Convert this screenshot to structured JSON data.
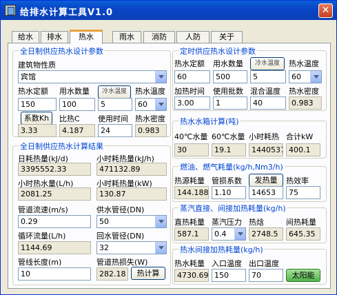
{
  "window": {
    "title": "给排水计算工具V1.0"
  },
  "tabs": [
    "给水",
    "排水",
    "热水",
    "雨水",
    "消防",
    "人防",
    "关于"
  ],
  "full_day": {
    "title": "全日制供应热水设计参数",
    "building_type_label": "建筑物性质",
    "building_type_value": "宾馆",
    "quota_label": "热水定额",
    "quota_value": "150",
    "units_label": "用水数量",
    "units_value": "100",
    "cold_temp_button": "冷水温度",
    "cold_temp_value": "5",
    "hot_temp_label": "热水温度",
    "hot_temp_value": "60",
    "coef_button": "系数Kh",
    "coef_value": "3.33",
    "specific_heat_label": "比热C",
    "specific_heat_value": "4.187",
    "use_time_label": "使用时间",
    "use_time_value": "24",
    "density_label": "热水密度",
    "density_value": "0.983"
  },
  "full_day_results": {
    "title": "全日制供应热水计算结果",
    "daily_heat_label": "日耗热量(kJ/d)",
    "daily_heat_value": "3395552.33",
    "hourly_heat_label": "小时耗热量(kJ/h)",
    "hourly_heat_value": "471132.89",
    "hourly_water_label": "小时热水量(L/h)",
    "hourly_water_value": "2081.25",
    "hourly_heat_kw_label": "小时耗热量(kW)",
    "hourly_heat_kw_value": "130.87",
    "flow_speed_label": "管道流速(m/s)",
    "flow_speed_value": "0.29",
    "supply_dia_label": "供水管径(DN)",
    "supply_dia_value": "50",
    "circ_flow_label": "循环流量(L/h)",
    "circ_flow_value": "1144.69",
    "return_dia_label": "回水管径(DN)",
    "return_dia_value": "32",
    "pipe_length_label": "管线长度(m)",
    "pipe_length_value": "10",
    "pipe_loss_label": "管道热损失(W)",
    "pipe_loss_value": "282.18",
    "calc_button": "热计算"
  },
  "timed": {
    "title": "定时供应热水设计参数",
    "quota_label": "热水定额",
    "quota_value": "60",
    "units_label": "用水数量",
    "units_value": "500",
    "cold_temp_button": "冷水温度",
    "cold_temp_value": "5",
    "hot_temp_label": "热水温度",
    "hot_temp_value": "60",
    "heat_time_label": "加热时间",
    "heat_time_value": "3.00",
    "batch_label": "使用批数",
    "batch_value": "1",
    "mix_temp_label": "混合温度",
    "mix_temp_value": "40",
    "density_label": "热水密度",
    "density_value": "0.983"
  },
  "tank": {
    "title": "热水水箱计算(吨)",
    "w40_label": "40℃水量",
    "w40_value": "30",
    "w60_label": "60℃水量",
    "w60_value": "19.1",
    "hourly_heat_label": "小时耗热",
    "hourly_heat_value": "1440537.",
    "total_kw_label": "合计kW",
    "total_kw_value": "400.1"
  },
  "fuel": {
    "title": "燃油、燃气耗量(kg/h,Nm3/h)",
    "heat_source_label": "热源耗量",
    "heat_source_value": "144.188",
    "pipe_loss_label": "管损系数",
    "pipe_loss_value": "1.10",
    "calorific_button": "发热量",
    "calorific_value": "14653",
    "efficiency_label": "热效率",
    "efficiency_value": "75"
  },
  "steam": {
    "title": "蒸汽直接、间接加热耗量(kg/h)",
    "direct_label": "直热耗量",
    "direct_value": "587.1",
    "pressure_label": "蒸汽压力",
    "pressure_value": "0.4",
    "enthalpy_label": "热焓",
    "enthalpy_value": "2748.5",
    "indirect_label": "间热耗量",
    "indirect_value": "645.35"
  },
  "indirect_water": {
    "title": "热水间接加热耗量(kg/h)",
    "consumption_label": "热水耗量",
    "consumption_value": "4730.69",
    "inlet_temp_label": "入口温度",
    "inlet_temp_value": "150",
    "outlet_temp_label": "出口温度",
    "outlet_temp_value": "70",
    "solar_button": "太阳能"
  },
  "colors": {
    "title_bar": "#0a4fd0",
    "group_title": "#0046d5",
    "tab_active_accent": "#e8a23a",
    "readonly_field": "#ece9d8",
    "solar_button": "#53b44a"
  }
}
